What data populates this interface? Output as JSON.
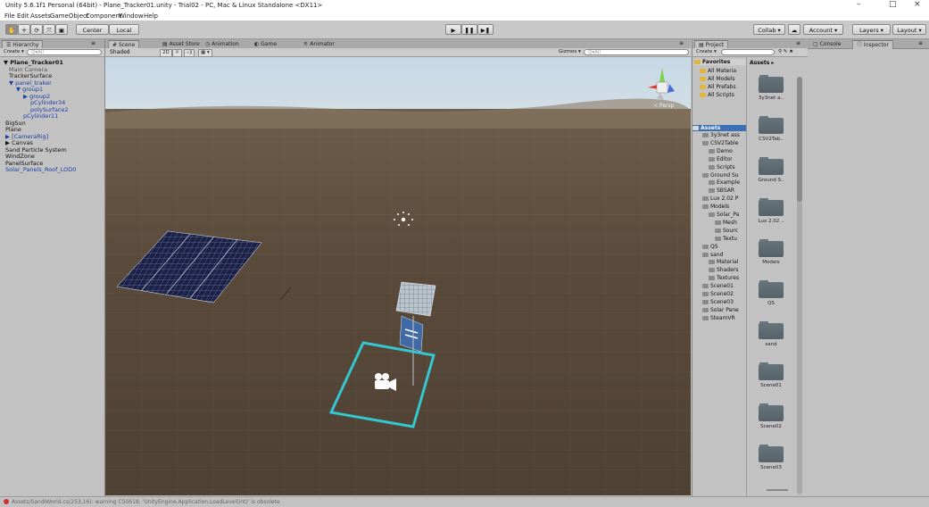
{
  "window": {
    "title": "Unity 5.6.1f1 Personal (64bit) - Plane_Tracker01.unity - Trial02 - PC, Mac & Linux Standalone <DX11>",
    "controls": [
      "–",
      "□",
      "×"
    ]
  },
  "menu": [
    "File",
    "Edit",
    "Assets",
    "GameObject",
    "Component",
    "Window",
    "Help"
  ],
  "toolbar": {
    "pivot": "Center",
    "space": "Local",
    "collab": "Collab ▾",
    "account": "Account ▾",
    "layers": "Layers ▾",
    "layout": "Layout ▾"
  },
  "hierarchy": {
    "tab": "Hierarchy",
    "create": "Create ▾",
    "search_placeholder": "Q▾All",
    "items": [
      {
        "label": "Plane_Tracker01",
        "style": "bold"
      },
      {
        "label": "Main Camera",
        "style": "grey"
      },
      {
        "label": "TrackerSurface",
        "style": ""
      },
      {
        "label": "panel_traker",
        "style": "blue"
      },
      {
        "label": "group1",
        "style": "blue"
      },
      {
        "label": "group2",
        "style": "blue"
      },
      {
        "label": "pCylinder34",
        "style": "blue"
      },
      {
        "label": "polySurface2",
        "style": "blue"
      },
      {
        "label": "pCylinder11",
        "style": "blue"
      },
      {
        "label": "BigSun",
        "style": ""
      },
      {
        "label": "Plane",
        "style": ""
      },
      {
        "label": "[CameraRig]",
        "style": "blue"
      },
      {
        "label": "Canvas",
        "style": ""
      },
      {
        "label": "Sand Particle System",
        "style": ""
      },
      {
        "label": "WindZone",
        "style": ""
      },
      {
        "label": "PanelSurface",
        "style": ""
      },
      {
        "label": "Solar_Panels_Roof_LOD0",
        "style": "blue"
      }
    ]
  },
  "scene": {
    "tabs": [
      "Scene",
      "Asset Store",
      "Animation",
      "Game",
      "Animator"
    ],
    "shading": "Shaded",
    "mode_2d": "2D",
    "gizmos": "Gizmos ▾",
    "search_placeholder": "Q▾All",
    "persp_label": "≺ Persp"
  },
  "project": {
    "tab": "Project",
    "create": "Create ▾",
    "favorites_title": "Favorites",
    "favorites": [
      "All Materia",
      "All Models",
      "All Prefabs",
      "All Scripts"
    ],
    "assets_root": "Assets",
    "tree": [
      {
        "label": "3y3net ass",
        "level": 1
      },
      {
        "label": "CSV2Table",
        "level": 1
      },
      {
        "label": "Demo",
        "level": 2
      },
      {
        "label": "Editor",
        "level": 2
      },
      {
        "label": "Scripts",
        "level": 2
      },
      {
        "label": "Ground Su",
        "level": 1
      },
      {
        "label": "Example",
        "level": 2
      },
      {
        "label": "SBSAR",
        "level": 2
      },
      {
        "label": "Lux 2.02 P",
        "level": 1
      },
      {
        "label": "Models",
        "level": 1
      },
      {
        "label": "Solar_Pa",
        "level": 2
      },
      {
        "label": "Mesh",
        "level": 3
      },
      {
        "label": "Sourc",
        "level": 3
      },
      {
        "label": "Textu",
        "level": 3
      },
      {
        "label": "QS",
        "level": 1
      },
      {
        "label": "sand",
        "level": 1
      },
      {
        "label": "Material",
        "level": 2
      },
      {
        "label": "Shaders",
        "level": 2
      },
      {
        "label": "Textures",
        "level": 2
      },
      {
        "label": "Scene01",
        "level": 1
      },
      {
        "label": "Scene02",
        "level": 1
      },
      {
        "label": "Scene03",
        "level": 1
      },
      {
        "label": "Solar Pane",
        "level": 1
      },
      {
        "label": "SteamVR",
        "level": 1
      }
    ],
    "grid_header": "Assets ▸",
    "grid_items": [
      "3y3net a..",
      "CSV2Tab..",
      "Ground S..",
      "Lux 2.02 ..",
      "Models",
      "QS",
      "sand",
      "Scene01",
      "Scene02",
      "Scene03"
    ]
  },
  "console": {
    "tab": "Console"
  },
  "inspector": {
    "tab": "Inspector"
  },
  "status": {
    "text": "Assets/SandIWorld.cs(253,16): warning CS0618: 'UnityEngine.Application.LoadLevel(int)' is obsolete"
  }
}
